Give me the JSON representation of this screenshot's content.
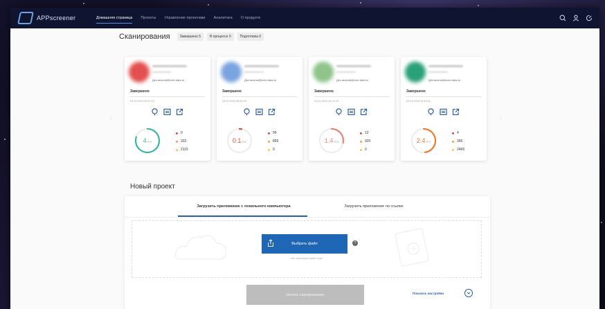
{
  "app": {
    "logo_text": "APPscreener"
  },
  "nav": {
    "items": [
      {
        "label": "Домашняя страница",
        "active": true
      },
      {
        "label": "Проекты"
      },
      {
        "label": "Управление проектами"
      },
      {
        "label": "Аналитика"
      },
      {
        "label": "О продукте"
      }
    ],
    "icons": [
      "search-icon",
      "user-icon",
      "logout-icon"
    ]
  },
  "scans": {
    "title": "Сканирования",
    "filters": [
      {
        "label": "Завершено 5"
      },
      {
        "label": "В процессе 0"
      },
      {
        "label": "Подготовка 0"
      }
    ]
  },
  "cards": [
    {
      "email": "Дev.anomal@cmd-data.ru",
      "status": "Завершено",
      "date": "24.01.2019 15:37:12",
      "score": "4",
      "score_max": "/5.0",
      "progress": 0.8,
      "color": "#3db5a0",
      "avatar": "#e35050",
      "counts": [
        "0",
        "332",
        "2115"
      ]
    },
    {
      "email": "Дev.anomal@cmd-data.ru",
      "status": "Завершено",
      "date": "24.01.2019 08:54:29",
      "score": "0.1",
      "score_max": "/5.0",
      "progress": 0.03,
      "color": "#e04a3a",
      "avatar": "#7aa4e0",
      "counts": [
        "99",
        "856",
        "0"
      ]
    },
    {
      "email": "Дev.anomal@cmd-data.ru",
      "status": "Завершено",
      "date": "21.01.2019 16:37:03",
      "score": "1.4",
      "score_max": "/5.0",
      "progress": 0.28,
      "color": "#f08070",
      "avatar": "#8ec48a",
      "counts": [
        "12",
        "920",
        "0"
      ]
    },
    {
      "email": "Дev.anomal@cmd-data.ru",
      "status": "Завершено",
      "date": "22.01.2019 13:43:21",
      "score": "2.4",
      "score_max": "/5.0",
      "progress": 0.48,
      "color": "#f07a30",
      "avatar": "#2aa07a",
      "counts": [
        "4",
        "366",
        "2466"
      ]
    }
  ],
  "count_colors": [
    "#e04a3a",
    "#f0a050",
    "#f5c542"
  ],
  "new_project": {
    "title": "Новый проект",
    "tab_local": "Загрузить приложение с локального компьютера",
    "tab_link": "Загрузить приложение по ссылке",
    "choose_file": "Выбрать файл",
    "drag_hint": "или перетащите файл сюда",
    "start_button": "Начать сканирование",
    "settings_link": "Показать настройки"
  }
}
